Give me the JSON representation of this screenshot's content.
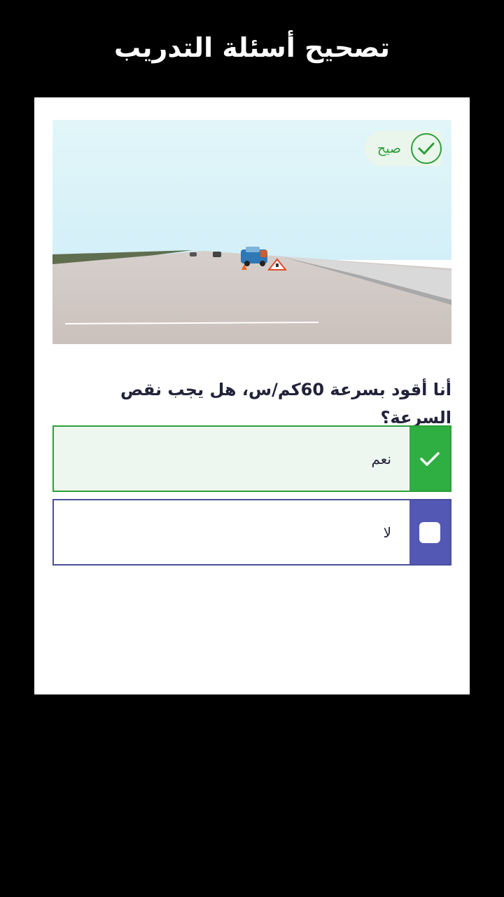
{
  "page": {
    "title": "تصحيح أسئلة التدريب"
  },
  "result": {
    "label": "صيح",
    "icon": "check-circle-icon",
    "color": "#2e9e3a"
  },
  "question": {
    "text": "أنا أقود بسرعة 60كم/س، هل يجب نقص السرعة؟"
  },
  "options": [
    {
      "label": "نعم",
      "state": "correct",
      "icon": "checkmark-icon",
      "color": "#2fae42"
    },
    {
      "label": "لا",
      "state": "unselected",
      "icon": "checkbox-icon",
      "color": "#5258b4"
    }
  ]
}
